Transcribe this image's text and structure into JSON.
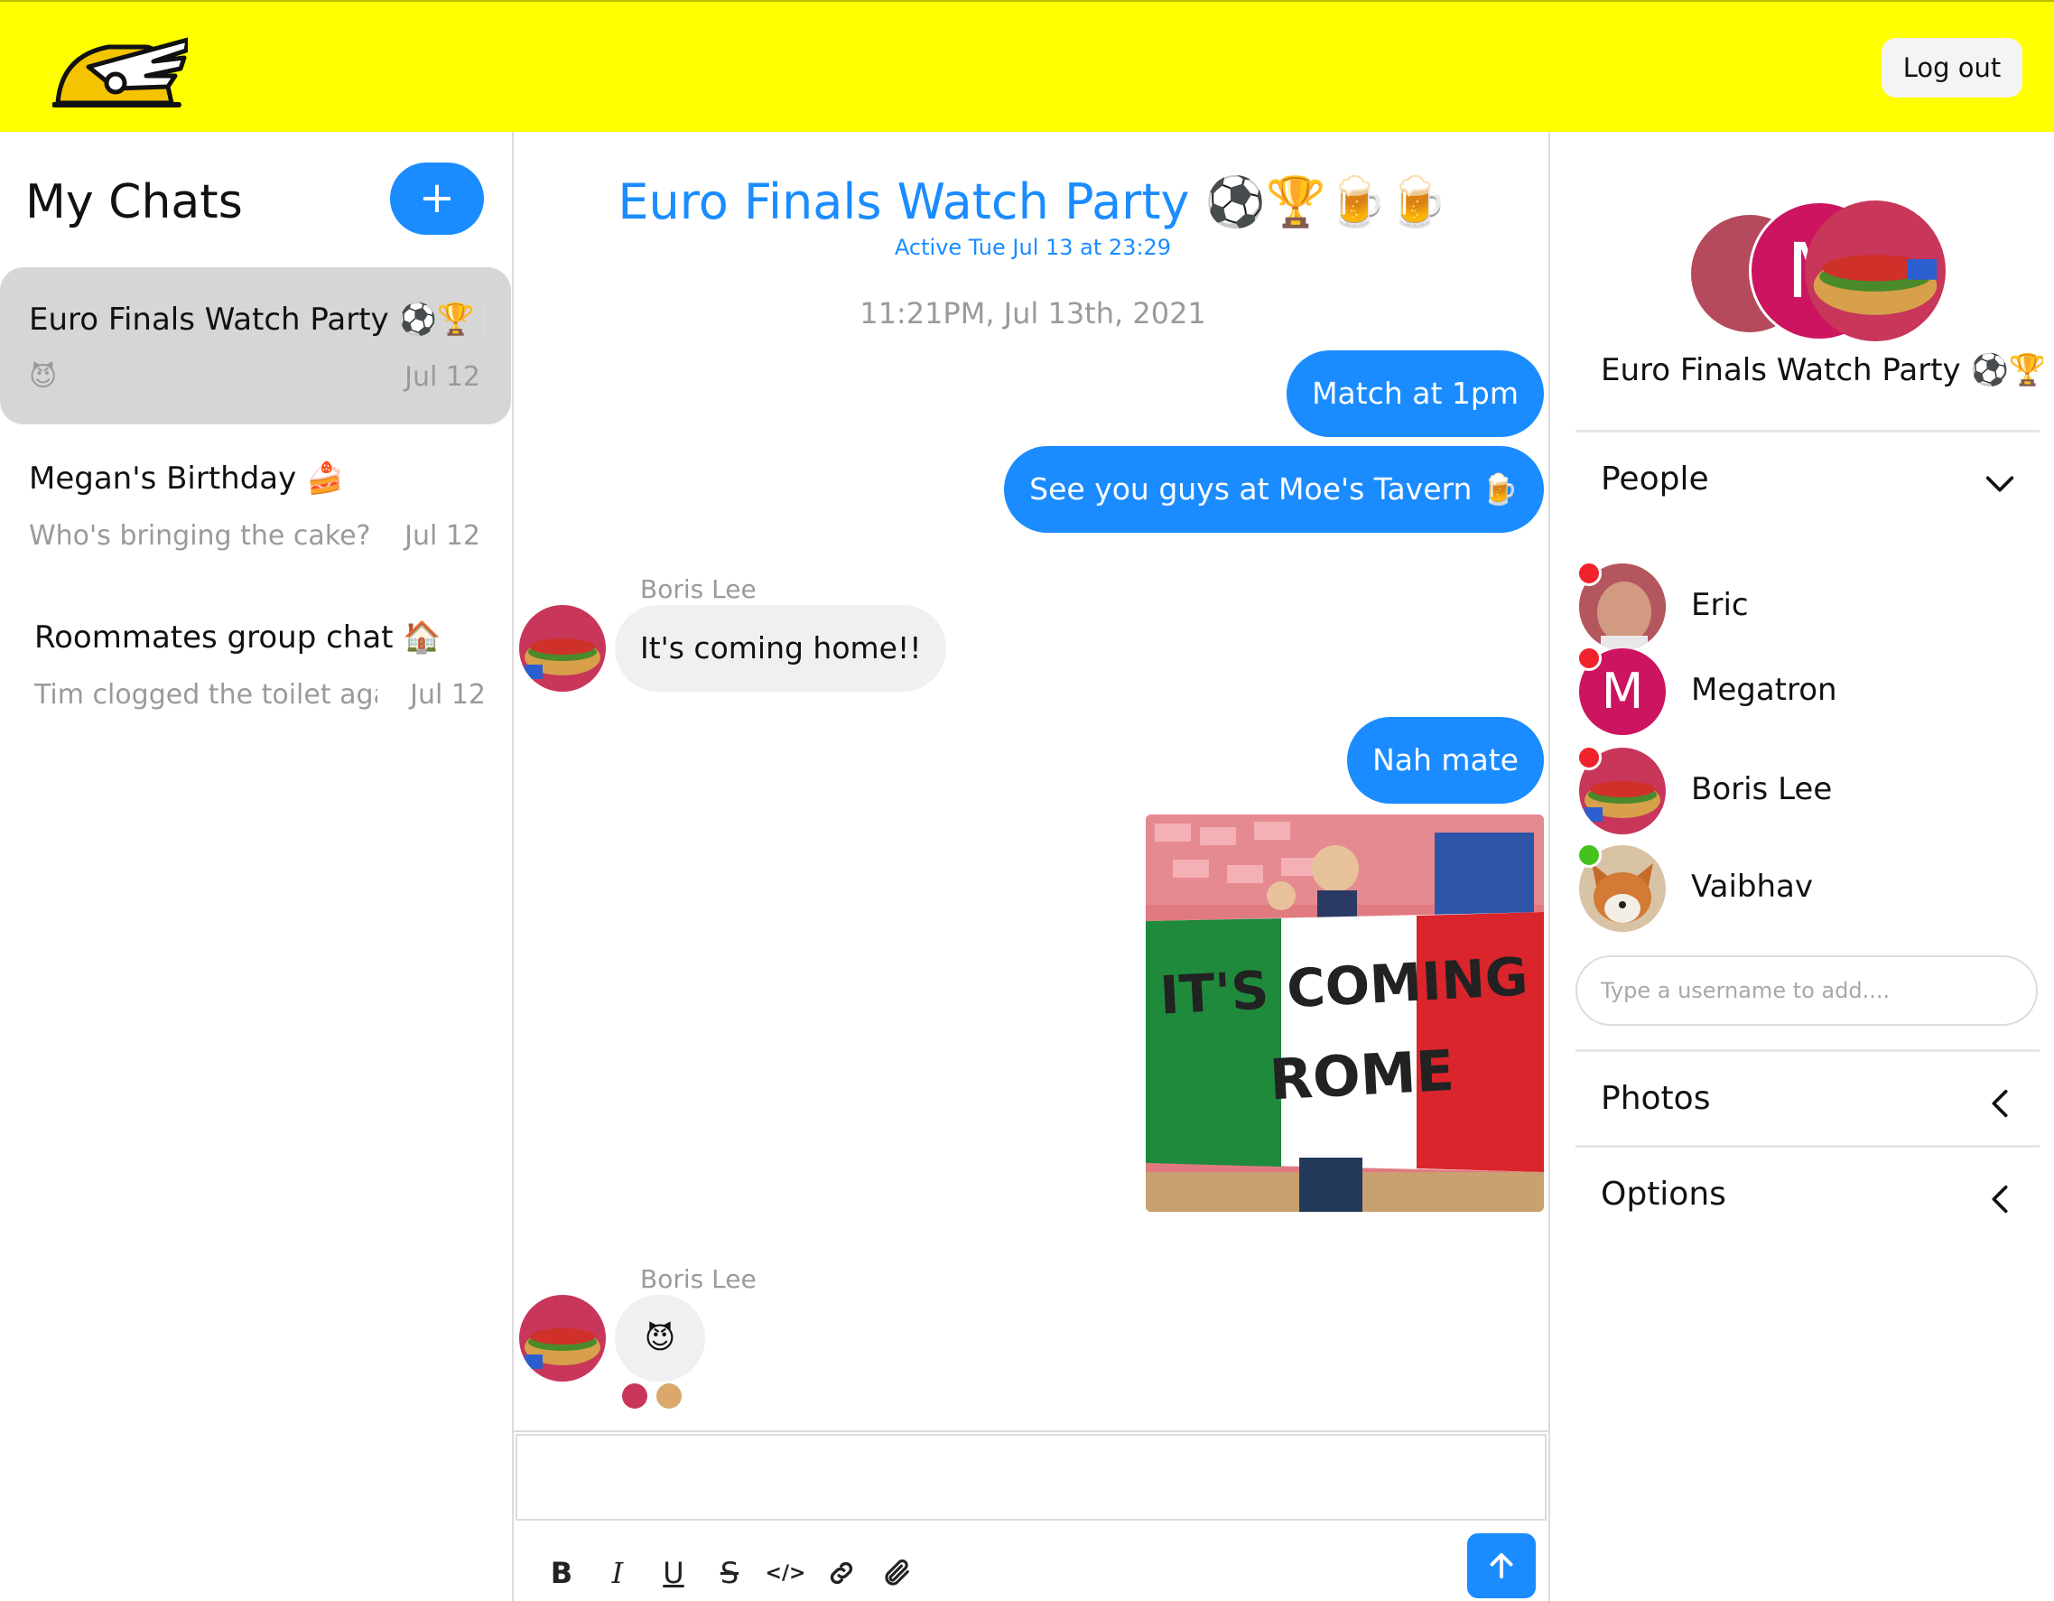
{
  "header": {
    "logout_label": "Log out"
  },
  "sidebar": {
    "title": "My Chats",
    "new_chat_label": "+",
    "chats": [
      {
        "name": "Euro Finals Watch Party ⚽🏆🍺",
        "preview": "😈",
        "date": "Jul 12"
      },
      {
        "name": "Megan's Birthday 🍰",
        "preview": "Who's bringing the cake?",
        "date": "Jul 12"
      },
      {
        "name": "Roommates group chat 🏠",
        "preview": "Tim clogged the toilet agair",
        "date": "Jul 12"
      }
    ]
  },
  "chat": {
    "title": "Euro Finals Watch Party ⚽🏆🍺🍺",
    "active": "Active Tue Jul 13 at 23:29",
    "timestamp": "11:21PM, Jul 13th, 2021",
    "messages": [
      {
        "text": "Match at 1pm"
      },
      {
        "text": "See you guys at Moe's Tavern 🍺"
      },
      {
        "sender": "Boris Lee",
        "text": "It's coming home!!"
      },
      {
        "text": "Nah mate"
      },
      {
        "photo_text_1": "IT'S COMING",
        "photo_text_2": "ROME"
      },
      {
        "sender": "Boris Lee",
        "text": "😈"
      }
    ]
  },
  "composer": {
    "value": "",
    "tools": [
      "B",
      "I",
      "U",
      "S",
      "</>",
      "link",
      "attach"
    ]
  },
  "details": {
    "group_name": "Euro Finals Watch Party ⚽🏆",
    "people_label": "People",
    "people": [
      {
        "name": "Eric",
        "status": "offline"
      },
      {
        "name": "Megatron",
        "initial": "M",
        "status": "offline"
      },
      {
        "name": "Boris Lee",
        "status": "offline"
      },
      {
        "name": "Vaibhav",
        "status": "online"
      }
    ],
    "add_placeholder": "Type a username to add....",
    "photos_label": "Photos",
    "options_label": "Options"
  },
  "colors": {
    "accent": "#1a8cff",
    "header": "#ffff00",
    "online": "#44c21e",
    "offline": "#f0222b",
    "megatron": "#cc1460"
  }
}
